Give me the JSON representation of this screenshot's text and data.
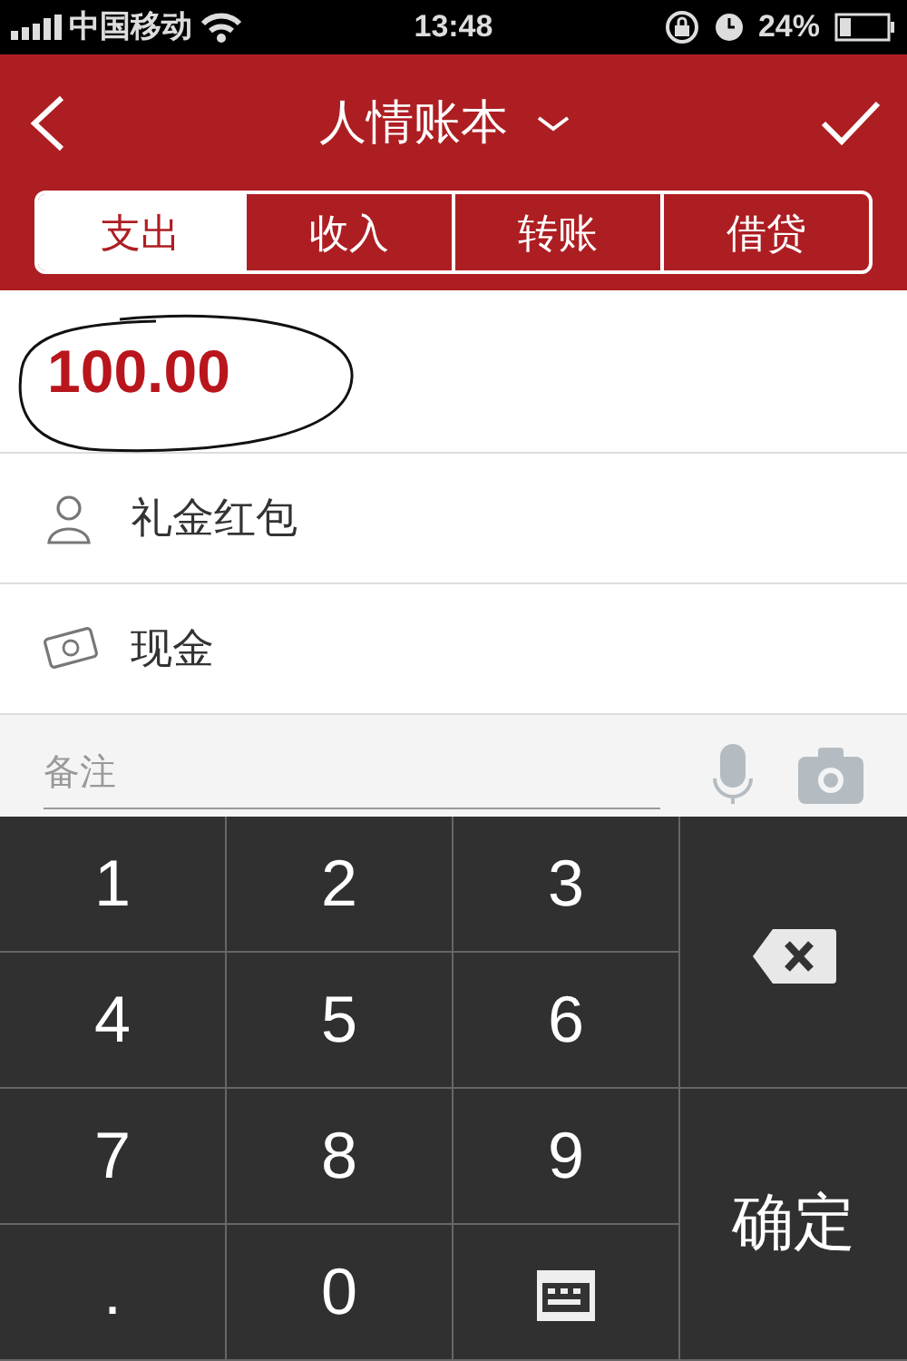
{
  "status_bar": {
    "carrier": "中国移动",
    "time": "13:48",
    "battery": "24%"
  },
  "header": {
    "title": "人情账本"
  },
  "tabs": [
    {
      "label": "支出",
      "selected": true
    },
    {
      "label": "收入",
      "selected": false
    },
    {
      "label": "转账",
      "selected": false
    },
    {
      "label": "借贷",
      "selected": false
    }
  ],
  "amount": "100.00",
  "fields": [
    {
      "kind": "category",
      "label": "礼金红包"
    },
    {
      "kind": "account",
      "label": "现金"
    }
  ],
  "note": {
    "placeholder": "备注"
  },
  "keypad": {
    "keys": [
      "1",
      "2",
      "3",
      "4",
      "5",
      "6",
      "7",
      "8",
      "9",
      ".",
      "0"
    ],
    "confirm": "确定"
  }
}
